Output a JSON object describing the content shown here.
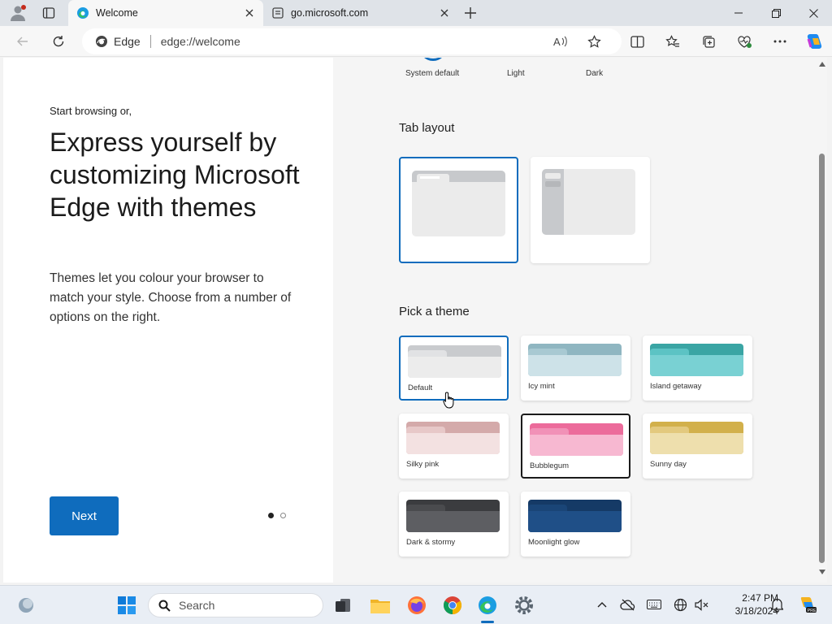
{
  "browser": {
    "tabs": [
      {
        "title": "Welcome",
        "active": true,
        "favicon": "edge-icon"
      },
      {
        "title": "go.microsoft.com",
        "active": false,
        "favicon": "page-icon"
      }
    ],
    "omnibox": {
      "site_label": "Edge",
      "url": "edge://welcome"
    }
  },
  "welcome": {
    "start_label": "Start browsing or,",
    "headline": "Express yourself by customizing Microsoft Edge with themes",
    "description": "Themes let you colour your browser to match your style. Choose from a number of options on the right.",
    "next_label": "Next",
    "step": {
      "current": 1,
      "total": 2
    }
  },
  "theme_modes": [
    "System default",
    "Light",
    "Dark"
  ],
  "tab_layout": {
    "title": "Tab layout",
    "options": [
      "horizontal",
      "vertical"
    ],
    "selected": "horizontal"
  },
  "pick_theme": {
    "title": "Pick a theme",
    "themes": [
      {
        "label": "Default",
        "back": "#c9cbce",
        "front": "#ececec",
        "tab": "#e1e2e4"
      },
      {
        "label": "Icy mint",
        "back": "#8fb6c1",
        "front": "#cde2e8",
        "tab": "#a8c9d2"
      },
      {
        "label": "Island getaway",
        "back": "#3aa5a4",
        "front": "#79d1d3",
        "tab": "#5cc3c4"
      },
      {
        "label": "Silky pink",
        "back": "#d4aaaa",
        "front": "#f3e1e1",
        "tab": "#e7c8c8"
      },
      {
        "label": "Bubblegum",
        "back": "#ec6b9b",
        "front": "#f7b8d1",
        "tab": "#f191b7"
      },
      {
        "label": "Sunny day",
        "back": "#d2b04b",
        "front": "#eedfad",
        "tab": "#e3c97e"
      },
      {
        "label": "Dark & stormy",
        "back": "#3b3c3f",
        "front": "#5d5e62",
        "tab": "#4a4b4e"
      },
      {
        "label": "Moonlight glow",
        "back": "#153a66",
        "front": "#1f4f87",
        "tab": "#1a4577"
      }
    ],
    "selected": "Bubblegum",
    "hovered": "Default"
  },
  "taskbar": {
    "search_label": "Search",
    "time": "2:47 PM",
    "date": "3/18/2024"
  },
  "colors": {
    "accent": "#0f6cbd"
  }
}
